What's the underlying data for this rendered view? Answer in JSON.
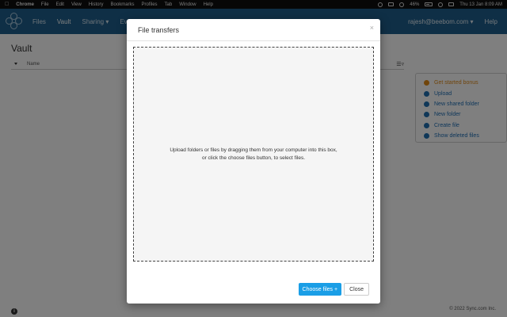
{
  "menubar": {
    "apple_icon": "apple-icon",
    "menus": [
      "Chrome",
      "File",
      "Edit",
      "View",
      "History",
      "Bookmarks",
      "Profiles",
      "Tab",
      "Window",
      "Help"
    ],
    "battery": "46%",
    "clock": "Thu 13 Jan  8:09 AM"
  },
  "navbar": {
    "items": [
      "Files",
      "Vault",
      "Sharing ▾",
      "Ev"
    ],
    "active_item": "Vault",
    "user": "rajesh@beebom.com ▾",
    "help": "Help",
    "color": "#1f5f8c"
  },
  "page": {
    "title": "Vault",
    "column_name": "Name"
  },
  "sidepanel": {
    "items": [
      {
        "label": "Get started bonus",
        "icon": "plus-circle-icon"
      },
      {
        "label": "Upload",
        "icon": "cloud-upload-icon"
      },
      {
        "label": "New shared folder",
        "icon": "shared-folder-icon"
      },
      {
        "label": "New folder",
        "icon": "folder-icon"
      },
      {
        "label": "Create file",
        "icon": "plus-circle-icon"
      },
      {
        "label": "Show deleted files",
        "icon": "trash-icon"
      }
    ]
  },
  "footer": {
    "info": "i",
    "copyright": "© 2022 Sync.com Inc."
  },
  "modal": {
    "title": "File transfers",
    "close": "×",
    "drop_text_line1": "Upload folders or files by dragging them from your computer into this box,",
    "drop_text_line2": "or click the choose files button, to select files.",
    "choose_button": "Choose files +",
    "close_button": "Close",
    "primary_color": "#1a9ee6"
  }
}
